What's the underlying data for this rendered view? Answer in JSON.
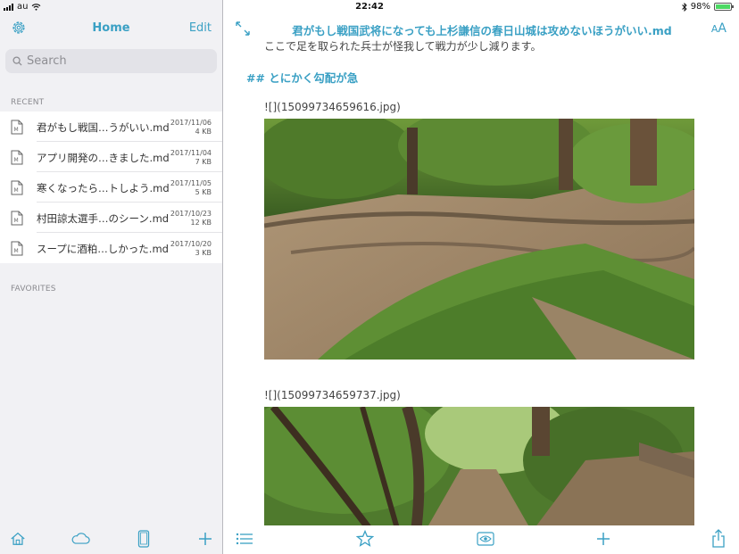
{
  "status_bar": {
    "carrier": "au",
    "time": "22:42",
    "battery": "98%",
    "battery_level": 0.98
  },
  "sidebar": {
    "title": "Home",
    "edit_label": "Edit",
    "search_placeholder": "Search",
    "recent_label": "RECENT",
    "favorites_label": "FAVORITES",
    "recent_files": [
      {
        "name": "君がもし戦国…うがいい.md",
        "date": "2017/11/06",
        "size": "4 KB"
      },
      {
        "name": "アプリ開発の…きました.md",
        "date": "2017/11/04",
        "size": "7 KB"
      },
      {
        "name": "寒くなったら…トしよう.md",
        "date": "2017/11/05",
        "size": "5 KB"
      },
      {
        "name": "村田諒太選手…のシーン.md",
        "date": "2017/10/23",
        "size": "12 KB"
      },
      {
        "name": "スープに酒粕…しかった.md",
        "date": "2017/10/20",
        "size": "3 KB"
      }
    ],
    "toolbar": [
      "home-icon",
      "cloud-icon",
      "device-icon",
      "add-icon"
    ]
  },
  "editor": {
    "doc_title": "君がもし戦国武将になっても上杉謙信の春日山城は攻めないほうがいい.md",
    "font_size_label_small": "A",
    "font_size_label_large": "A",
    "partial_line": "ここで足を取られた兵士が怪我して戦力が少し減ります。",
    "heading": "## とにかく勾配が急",
    "image_ref_1": "![](15099734659616.jpg)",
    "image_ref_2": "![](15099734659737.jpg)",
    "toolbar": [
      "list-icon",
      "star-icon",
      "preview-eye-icon",
      "add-icon",
      "share-icon"
    ]
  },
  "colors": {
    "accent": "#3aa0c4",
    "sidebar_bg": "#f1f1f4"
  }
}
